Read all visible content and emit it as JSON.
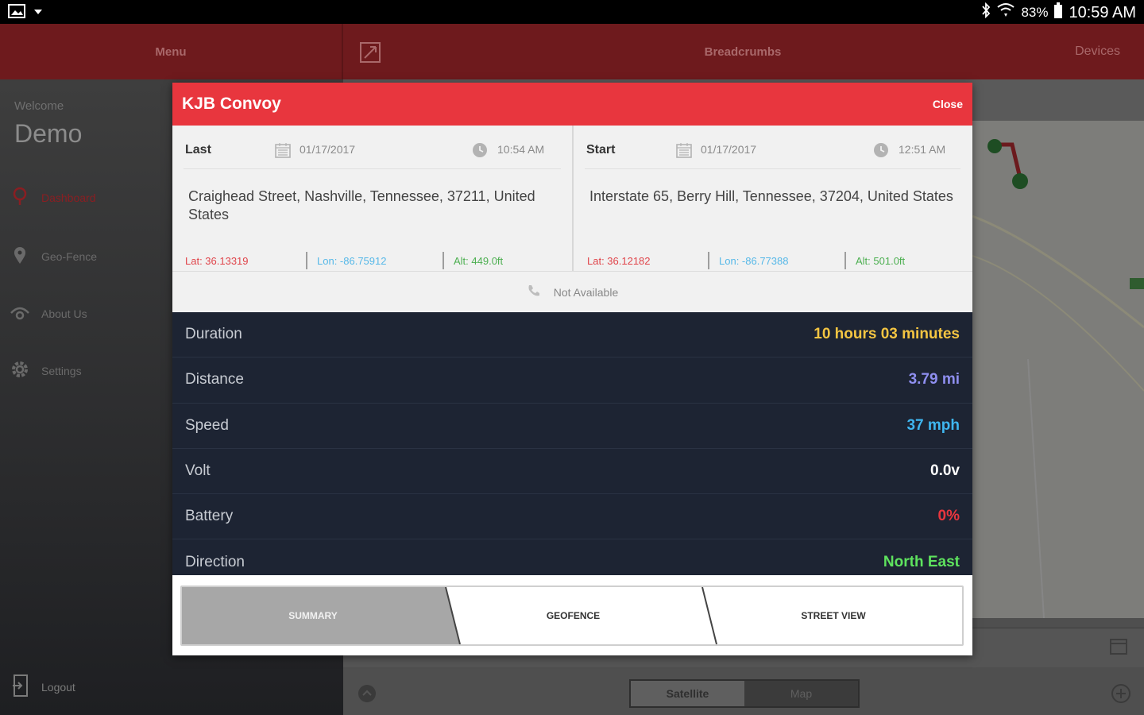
{
  "status_bar": {
    "battery_percent": "83%",
    "time": "10:59 AM",
    "icons": [
      "gallery-icon",
      "notification-icon",
      "bluetooth-icon",
      "wifi-icon",
      "battery-icon"
    ]
  },
  "header": {
    "menu_label": "Menu",
    "breadcrumbs_label": "Breadcrumbs",
    "devices_label": "Devices"
  },
  "sidebar": {
    "welcome": "Welcome",
    "user": "Demo",
    "items": [
      {
        "label": "Dashboard",
        "icon": "location-pin-icon",
        "active": true
      },
      {
        "label": "Geo-Fence",
        "icon": "map-pin-icon",
        "active": false
      },
      {
        "label": "About Us",
        "icon": "info-icon",
        "active": false
      },
      {
        "label": "Settings",
        "icon": "gear-icon",
        "active": false
      }
    ],
    "logout": "Logout"
  },
  "map": {
    "toggle": {
      "satellite": "Satellite",
      "map": "Map",
      "selected": "Satellite"
    }
  },
  "dialog": {
    "title": "KJB Convoy",
    "close": "Close",
    "last": {
      "label": "Last",
      "date": "01/17/2017",
      "time": "10:54 AM",
      "address": "Craighead Street, Nashville, Tennessee, 37211, United States",
      "lat": "Lat: 36.13319",
      "lon": "Lon: -86.75912",
      "alt": "Alt: 449.0ft"
    },
    "start": {
      "label": "Start",
      "date": "01/17/2017",
      "time": "12:51 AM",
      "address": "Interstate 65, Berry Hill, Tennessee, 37204, United States",
      "lat": "Lat: 36.12182",
      "lon": "Lon: -86.77388",
      "alt": "Alt: 501.0ft"
    },
    "phone": "Not Available",
    "stats": [
      {
        "label": "Duration",
        "value": "10 hours 03 minutes",
        "color": "#f4c542"
      },
      {
        "label": "Distance",
        "value": "3.79 mi",
        "color": "#8f8ff0"
      },
      {
        "label": "Speed",
        "value": "37 mph",
        "color": "#3fb6f0"
      },
      {
        "label": "Volt",
        "value": "0.0v",
        "color": "#ffffff"
      },
      {
        "label": "Battery",
        "value": "0%",
        "color": "#e8363e"
      },
      {
        "label": "Direction",
        "value": "North East",
        "color": "#5ee35e"
      }
    ],
    "tabs": {
      "summary": "SUMMARY",
      "geofence": "GEOFENCE",
      "street_view": "STREET VIEW",
      "selected": "SUMMARY"
    }
  }
}
